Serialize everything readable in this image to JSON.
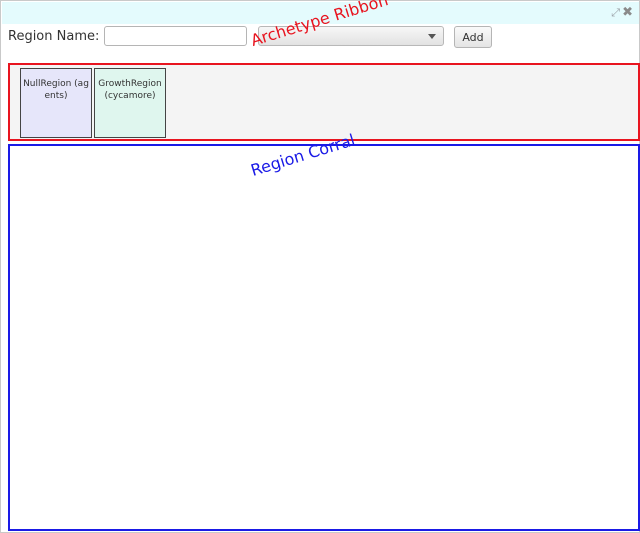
{
  "window": {
    "icons": [
      "expand-icon",
      "close-icon"
    ],
    "expand_glyph": "⤢",
    "close_glyph": "✖"
  },
  "toolbar": {
    "region_label": "Region Name:",
    "name_input_value": "",
    "select_value": "",
    "add_label": "Add"
  },
  "ribbon": {
    "caption": "Archetype Ribbon",
    "archetypes": [
      {
        "label": "NullRegion (agents)"
      },
      {
        "label": "GrowthRegion (cycamore)"
      }
    ]
  },
  "corral": {
    "caption": "Region Corral"
  },
  "colors": {
    "titlebar": "#e4fbfd",
    "ribbon_border": "#e8141f",
    "corral_border": "#1a1ae6",
    "null_region_bg": "#e6e6fa",
    "growth_region_bg": "#dff6ee"
  }
}
